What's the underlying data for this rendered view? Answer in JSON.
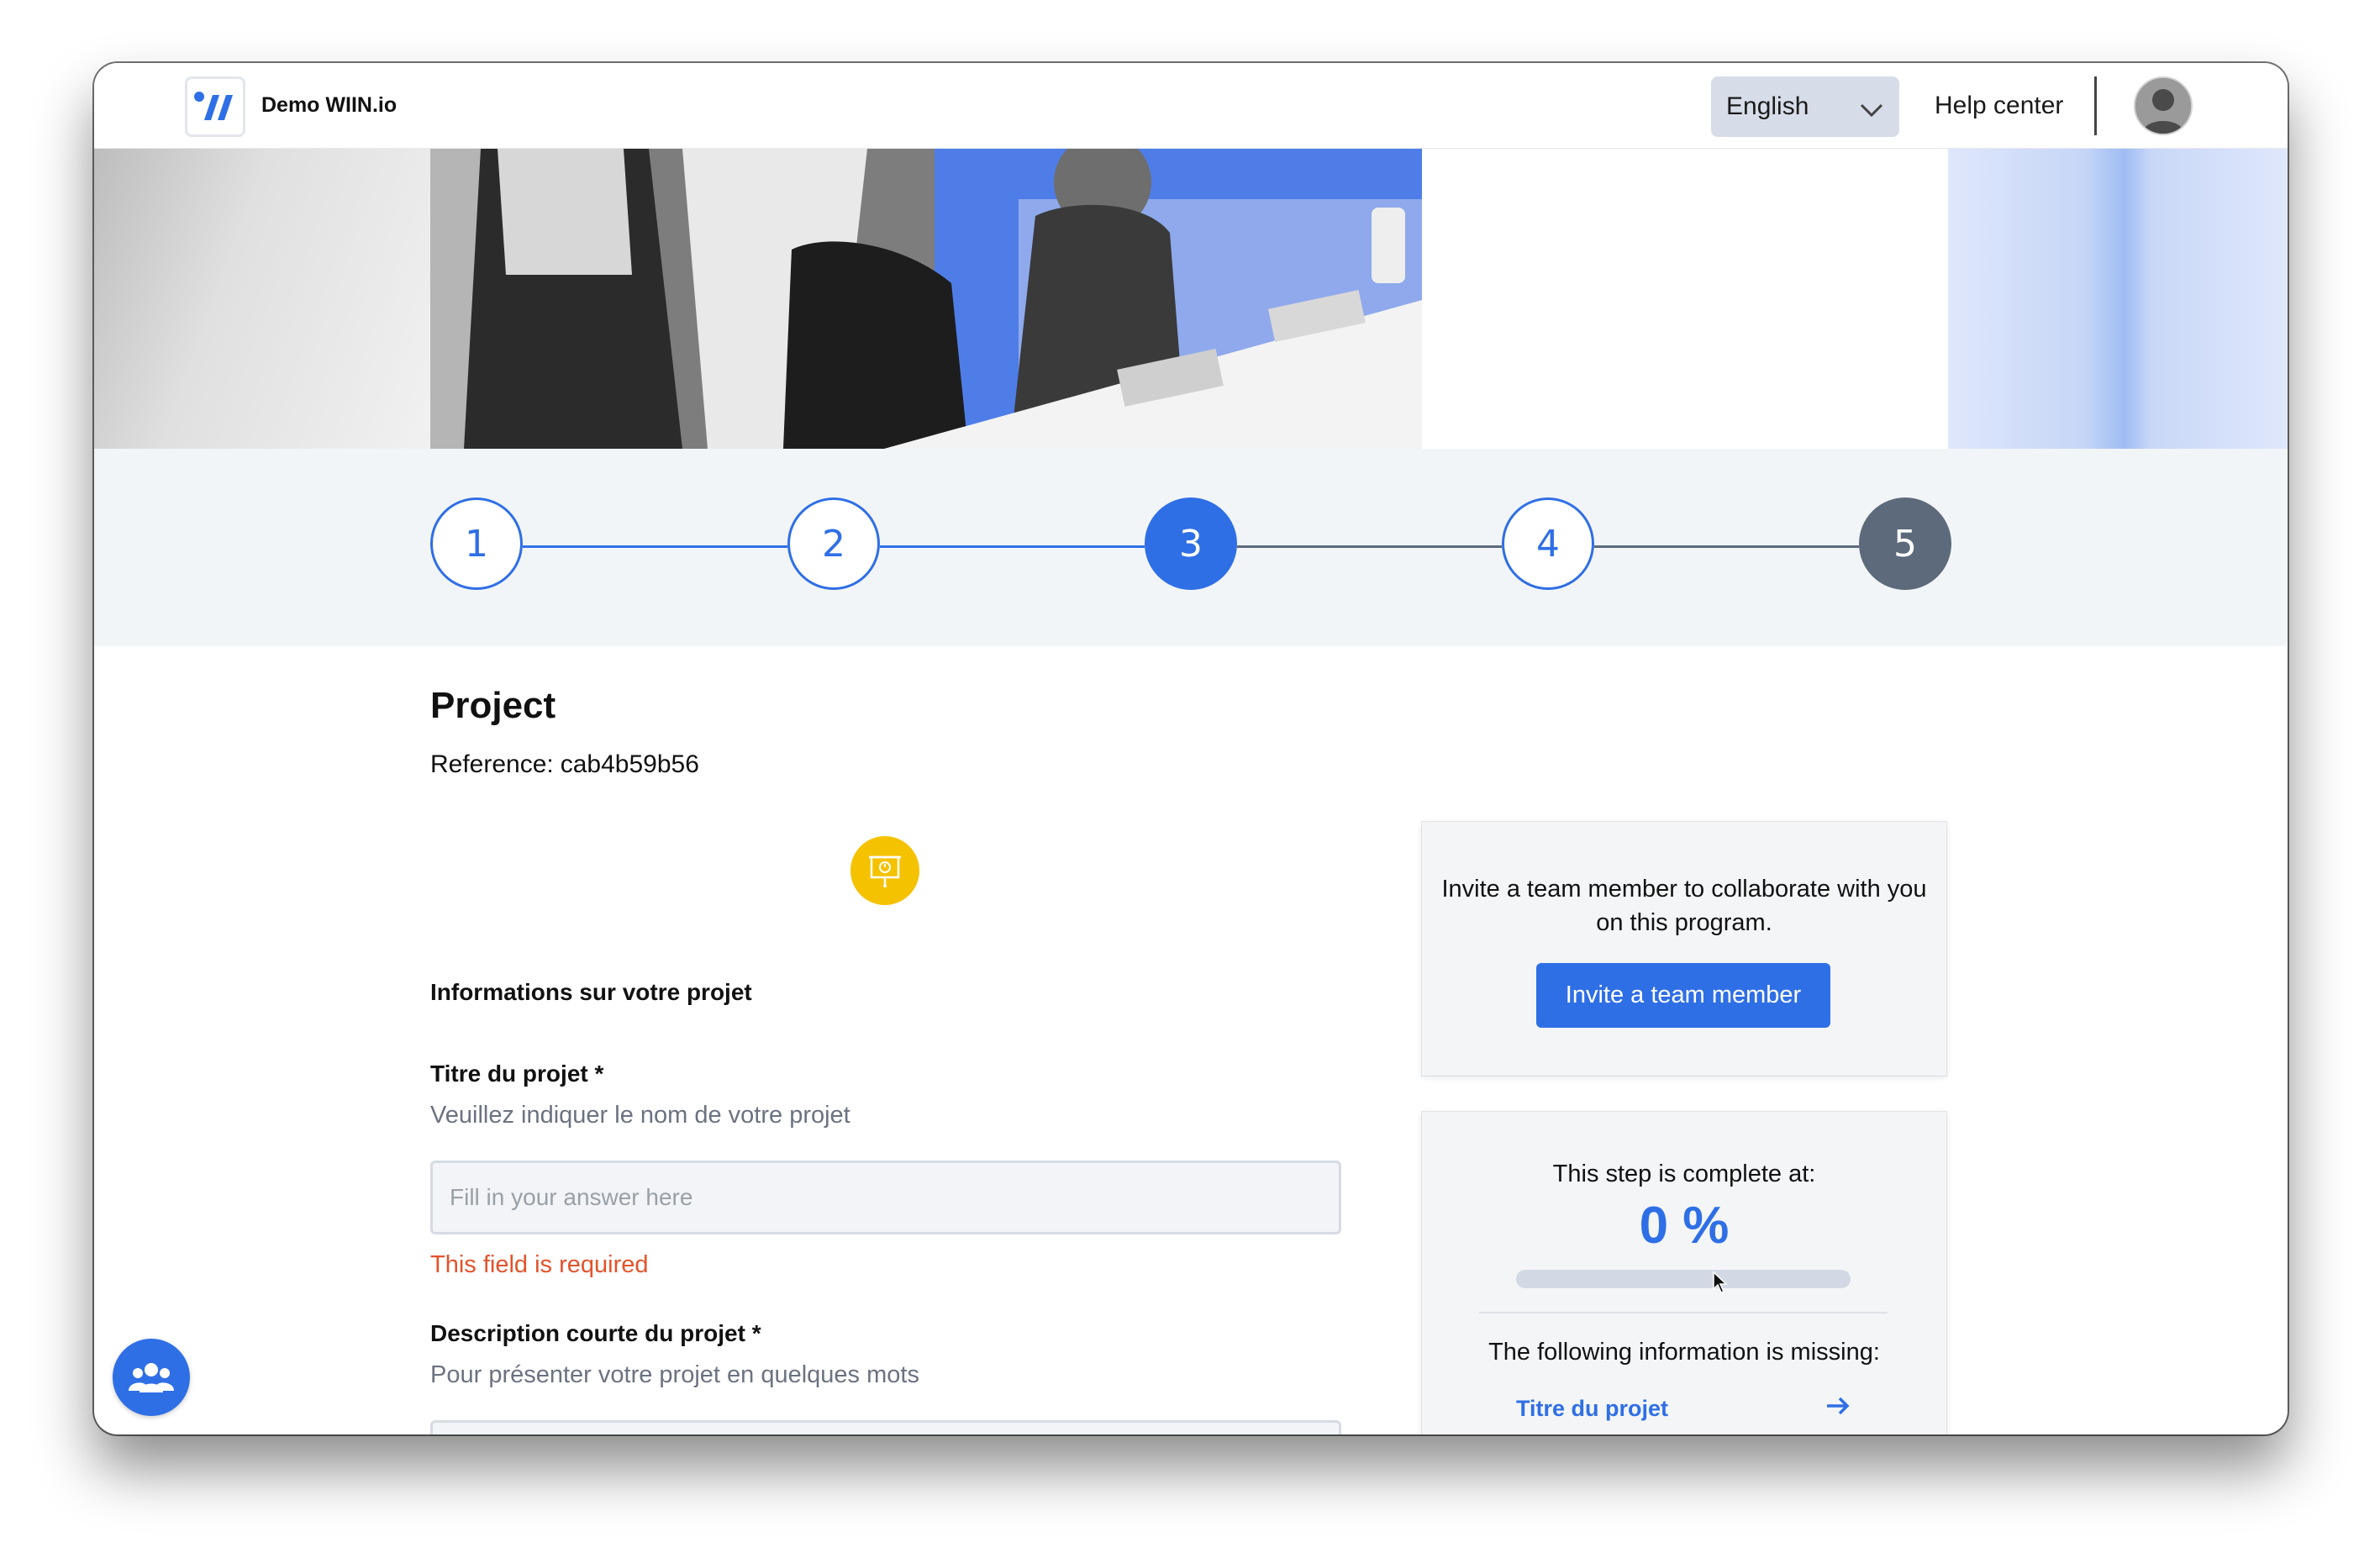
{
  "header": {
    "app_title": "Demo WIIN.io",
    "language": "English",
    "help_center": "Help center"
  },
  "stepper": {
    "steps": [
      {
        "label": "1",
        "state": "done"
      },
      {
        "label": "2",
        "state": "done"
      },
      {
        "label": "3",
        "state": "current"
      },
      {
        "label": "4",
        "state": "upcoming"
      },
      {
        "label": "5",
        "state": "locked"
      }
    ]
  },
  "main": {
    "title": "Project",
    "reference_label": "Reference:",
    "reference_value": "cab4b59b56",
    "section_heading": "Informations sur votre projet",
    "fields": [
      {
        "label": "Titre du projet *",
        "help": "Veuillez indiquer le nom de votre projet",
        "placeholder": "Fill in your answer here",
        "value": "",
        "error": "This field is required"
      },
      {
        "label": "Description courte du projet *",
        "help": "Pour présenter votre projet en quelques mots",
        "placeholder": "",
        "value": ""
      }
    ]
  },
  "sidebar": {
    "invite": {
      "text": "Invite a team member to collaborate with you on this program.",
      "button": "Invite a team member"
    },
    "progress": {
      "label": "This step is complete at:",
      "value_text": "0 %",
      "fraction": 0,
      "missing_label": "The following information is missing:",
      "missing_items": [
        "Titre du projet"
      ]
    }
  },
  "colors": {
    "primary": "#2f6fe6",
    "error": "#e3532b",
    "step_locked": "#5d6a7c",
    "project_icon_bg": "#f5c200",
    "band_bg": "#f2f5f8"
  },
  "icons": {
    "logo": "wiin-logo-icon",
    "language_chevron": "chevron-down-icon",
    "avatar": "user-avatar-icon",
    "project": "presentation-board-icon",
    "missing_arrow": "arrow-right-icon",
    "fab": "team-group-icon"
  }
}
